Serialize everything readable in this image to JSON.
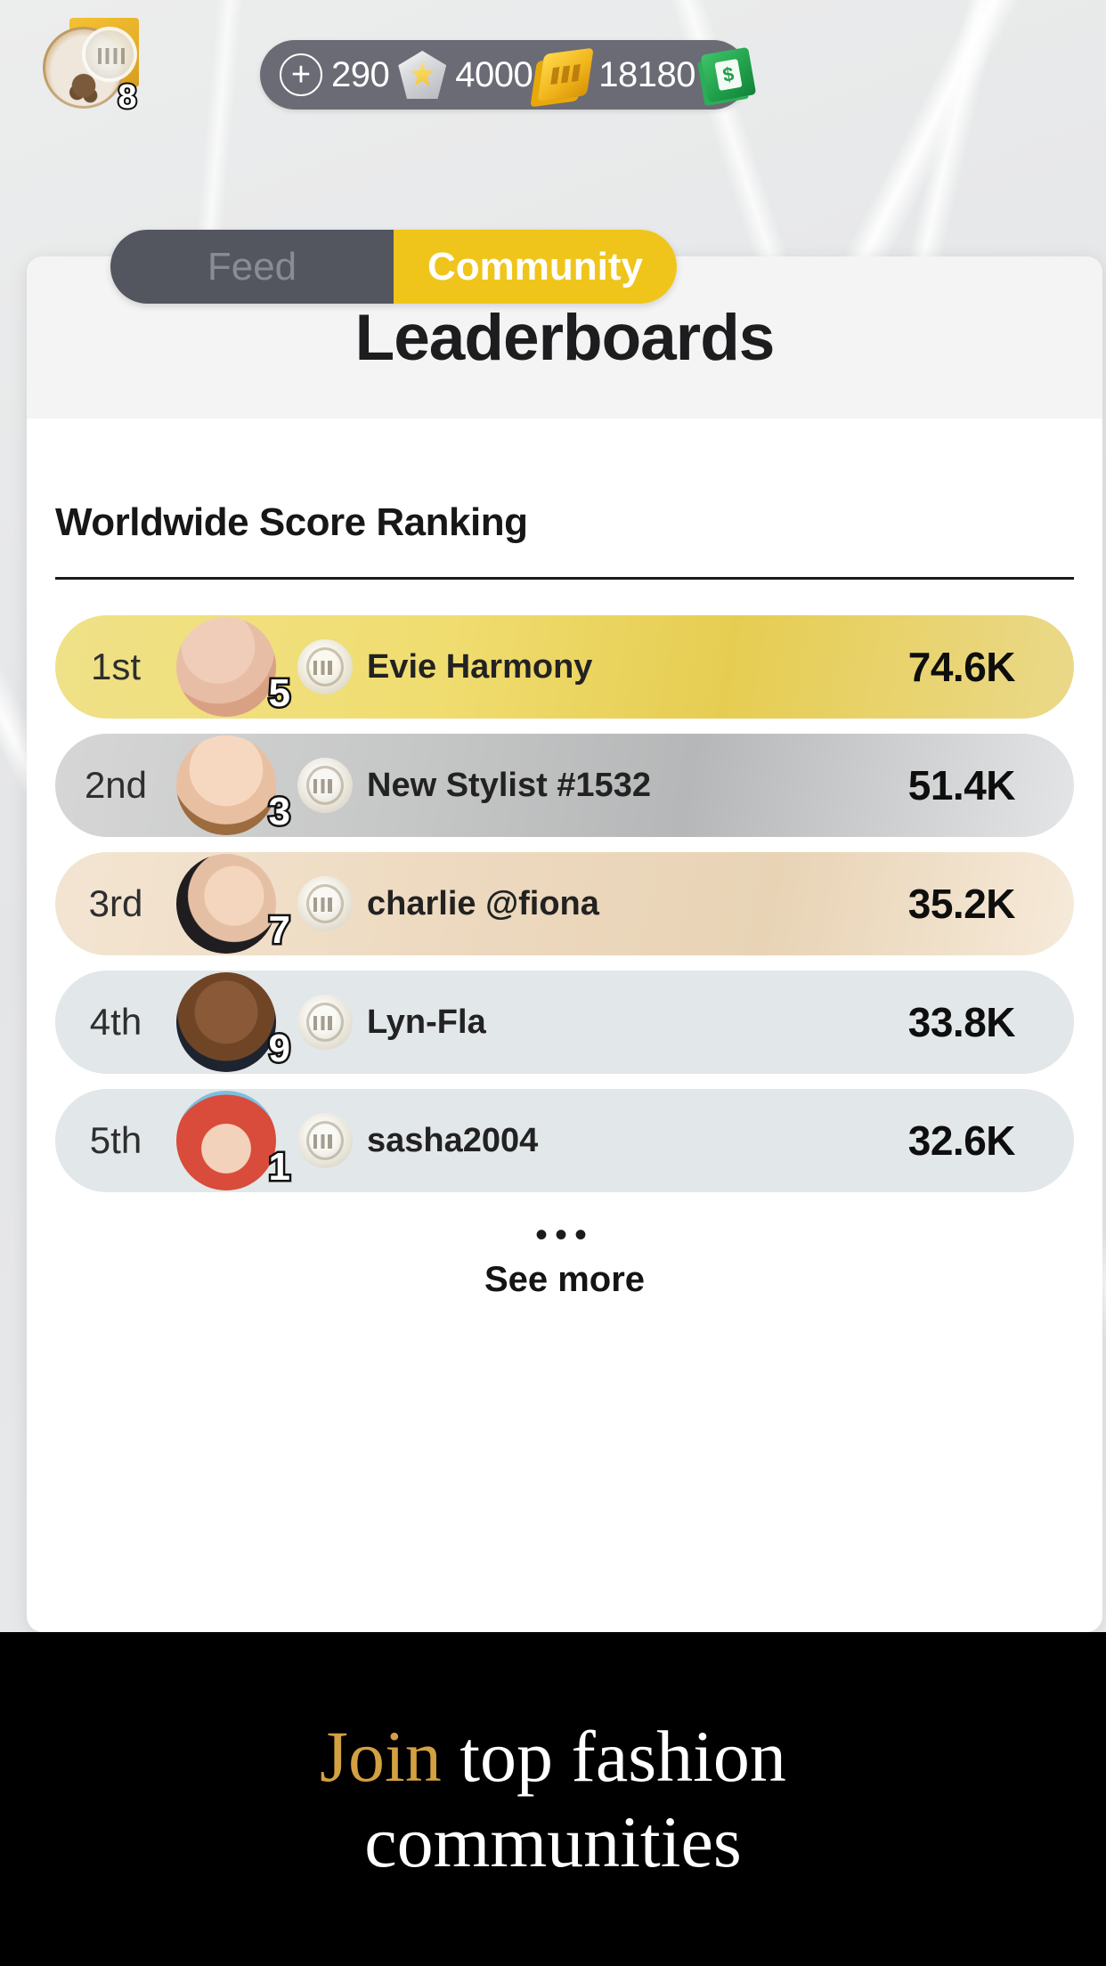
{
  "topbar": {
    "avatar_badge": "8",
    "currency": {
      "add_label": "+",
      "items": [
        {
          "icon": "gem-icon",
          "value": "290"
        },
        {
          "icon": "ticket-icon",
          "value": "4000"
        },
        {
          "icon": "cash-icon",
          "value": "18180"
        }
      ]
    }
  },
  "tabs": {
    "feed_label": "Feed",
    "community_label": "Community",
    "active": "Community",
    "active_color": "#efc51b"
  },
  "card": {
    "title": "Leaderboards",
    "section_title": "Worldwide Score Ranking",
    "see_more_dots": "•••",
    "see_more_label": "See more"
  },
  "leaderboard": [
    {
      "rank": "1st",
      "badge": "5",
      "name": "Evie Harmony",
      "score": "74.6K",
      "tier_color": "#ead96f"
    },
    {
      "rank": "2nd",
      "badge": "3",
      "name": "New Stylist #1532",
      "score": "51.4K",
      "tier_color": "#c7c8c9"
    },
    {
      "rank": "3rd",
      "badge": "7",
      "name": "charlie @fiona",
      "score": "35.2K",
      "tier_color": "#edd9bf"
    },
    {
      "rank": "4th",
      "badge": "9",
      "name": "Lyn-Fla",
      "score": "33.8K",
      "tier_color": "#e2e7e9"
    },
    {
      "rank": "5th",
      "badge": "1",
      "name": "sasha2004",
      "score": "32.6K",
      "tier_color": "#e2e7e9"
    }
  ],
  "banner": {
    "word_join": "Join",
    "line1_rest": " top fashion",
    "line2": "communities",
    "accent_color": "#d3a042",
    "background_color": "#000000"
  }
}
